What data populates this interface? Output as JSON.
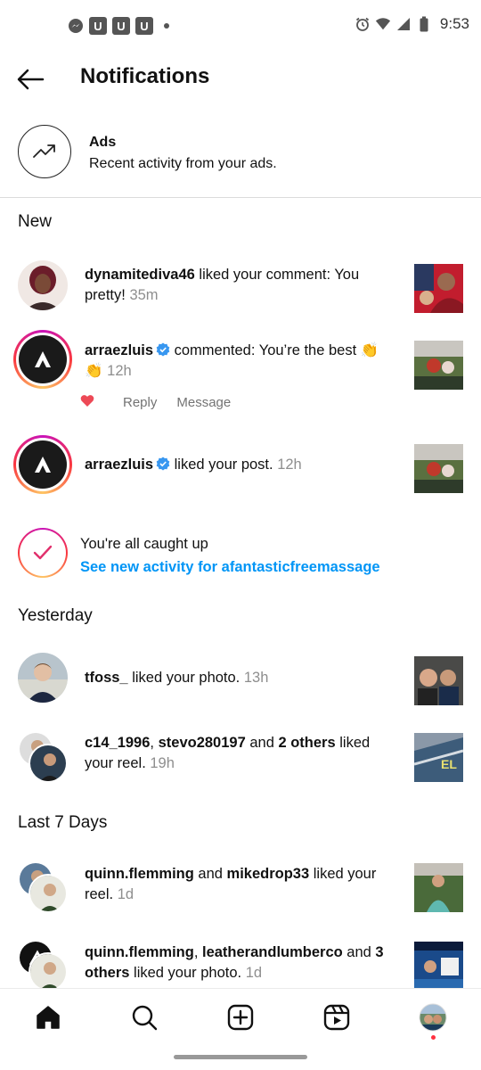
{
  "status_bar": {
    "time": "9:53",
    "left_icons": [
      "messenger-icon",
      "u-app-icon",
      "u-app-icon",
      "u-app-icon",
      "dot"
    ],
    "u_label": "U",
    "right_icons": [
      "alarm-icon",
      "wifi-icon",
      "signal-icon",
      "battery-icon"
    ]
  },
  "header": {
    "title": "Notifications"
  },
  "ads": {
    "title": "Ads",
    "subtitle": "Recent activity from your ads."
  },
  "sections": {
    "new": "New",
    "yesterday": "Yesterday",
    "last7": "Last 7 Days"
  },
  "notifications_new": [
    {
      "user": "dynamitediva46",
      "text": " liked your comment: You pretty! ",
      "time": "35m"
    },
    {
      "user": "arraezluis",
      "text": " commented: You’re the best 👏👏 ",
      "time": "12h",
      "verified": true,
      "reply": "Reply",
      "message": "Message"
    },
    {
      "user": "arraezluis",
      "text": " liked your post. ",
      "time": "12h",
      "verified": true
    }
  ],
  "caught_up": {
    "title": "You're all caught up",
    "link": "See new activity for afantasticfreemassage"
  },
  "notifications_yesterday": [
    {
      "user": "tfoss_",
      "text": " liked your photo. ",
      "time": "13h"
    },
    {
      "user1": "c14_1996",
      "sep": ", ",
      "user2": "stevo280197",
      "and": " and ",
      "others": "2 others",
      "text": " liked your reel. ",
      "time": "19h"
    }
  ],
  "notifications_last7": [
    {
      "user1": "quinn.flemming",
      "and": " and ",
      "user2": "mikedrop33",
      "text": " liked your reel. ",
      "time": "1d"
    },
    {
      "user1": "quinn.flemming",
      "sep": ", ",
      "user2": "leatherandlumberco",
      "and": " and ",
      "others": "3 others",
      "text": " liked your photo. ",
      "time": "1d"
    }
  ],
  "bottom_nav": [
    "home-icon",
    "search-icon",
    "create-icon",
    "reels-icon",
    "profile-avatar"
  ],
  "colors": {
    "link": "#0095f6",
    "like": "#ed4956",
    "verified": "#3897f0"
  }
}
